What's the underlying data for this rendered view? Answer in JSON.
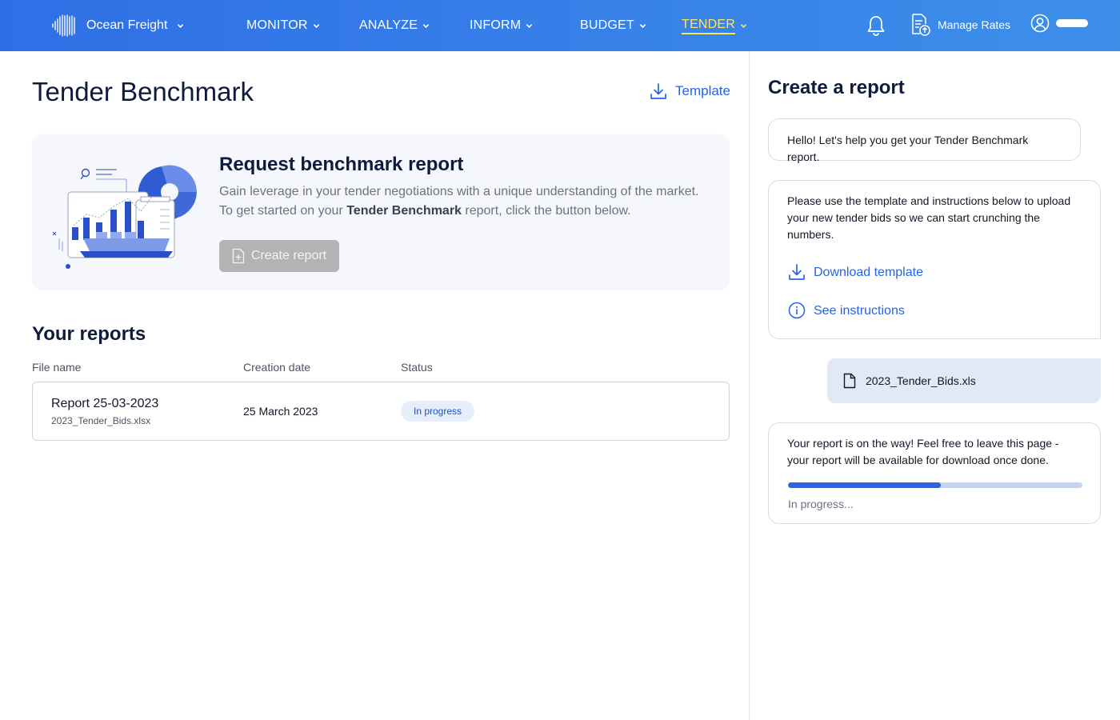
{
  "nav": {
    "brand": "Ocean Freight",
    "items": [
      {
        "label": "MONITOR",
        "active": false
      },
      {
        "label": "ANALYZE",
        "active": false
      },
      {
        "label": "INFORM",
        "active": false
      },
      {
        "label": "BUDGET",
        "active": false
      },
      {
        "label": "TENDER",
        "active": true
      }
    ],
    "manage_rates": "Manage Rates",
    "active_color": "#ffe566"
  },
  "main": {
    "title": "Tender Benchmark",
    "template_link": "Template",
    "request_card": {
      "title": "Request benchmark report",
      "desc_line1": "Gain leverage in your tender negotiations with a unique understanding of the market.",
      "desc_prefix": "To get started on your ",
      "desc_bold": "Tender Benchmark",
      "desc_suffix": " report, click the button below.",
      "button_label": "Create report"
    },
    "reports": {
      "title": "Your reports",
      "columns": [
        "File name",
        "Creation date",
        "Status"
      ],
      "rows": [
        {
          "name": "Report 25-03-2023",
          "file": "2023_Tender_Bids.xlsx",
          "date": "25 March 2023",
          "status": "In progress"
        }
      ]
    }
  },
  "panel": {
    "title": "Create a report",
    "greeting": "Hello! Let's help you get your Tender Benchmark report.",
    "instructions": "Please use the template and instructions below to upload your new tender bids so we can start crunching the numbers.",
    "download_template": "Download template",
    "see_instructions": "See instructions",
    "uploaded_file": "2023_Tender_Bids.xls",
    "status_message": "Your report is on the way! Feel free to leave this page - your report will be available for download once done.",
    "progress_label": "In progress...",
    "progress_fraction": 0.52
  },
  "colors": {
    "primary": "#2563eb",
    "progress_fill": "#2d62e3",
    "progress_track": "#c4d4f3",
    "status_badge_bg": "#e6eefb"
  }
}
